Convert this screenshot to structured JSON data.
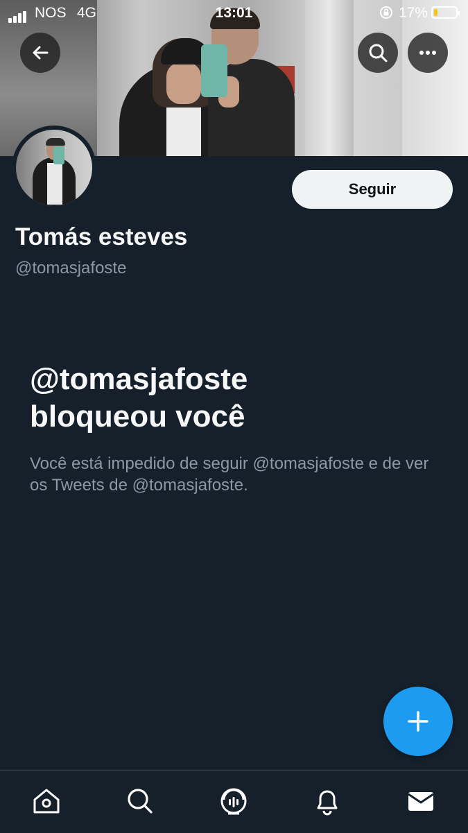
{
  "status_bar": {
    "carrier": "NOS",
    "network": "4G",
    "time": "13:01",
    "battery_percent": "17%",
    "battery_level": 0.17,
    "battery_color": "#f5c518",
    "icons": [
      "signal-icon",
      "orientation-lock-icon",
      "battery-icon"
    ]
  },
  "header": {
    "buttons": [
      {
        "name": "back",
        "icon": "arrow-left-icon"
      },
      {
        "name": "search",
        "icon": "search-icon"
      },
      {
        "name": "more",
        "icon": "more-horizontal-icon"
      }
    ]
  },
  "profile": {
    "display_name": "Tomás esteves",
    "handle": "@tomasjafoste",
    "follow_label": "Seguir"
  },
  "blocked": {
    "title_line1": "@tomasjafoste",
    "title_line2": "bloqueou você",
    "message": "Você está impedido de seguir @tomasjafoste e de ver os Tweets de @tomasjafoste."
  },
  "fab": {
    "icon": "plus-icon",
    "color": "#1d9bf0"
  },
  "bottom_nav": [
    {
      "name": "home",
      "icon": "home-icon"
    },
    {
      "name": "search",
      "icon": "search-icon"
    },
    {
      "name": "spaces",
      "icon": "spaces-icon"
    },
    {
      "name": "notifications",
      "icon": "bell-icon"
    },
    {
      "name": "messages",
      "icon": "envelope-icon"
    }
  ],
  "colors": {
    "background": "#15202b",
    "primary_text": "#f7f9f9",
    "secondary_text": "#8b98a5",
    "accent": "#1d9bf0"
  }
}
